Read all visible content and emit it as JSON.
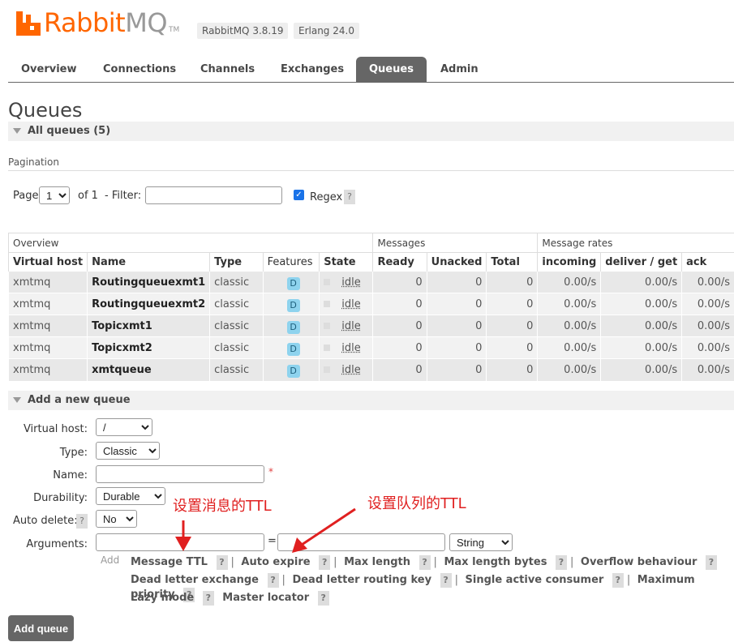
{
  "header": {
    "brand_part1": "Rabbit",
    "brand_part2": "MQ",
    "trademark": "TM",
    "version_rabbitmq": "RabbitMQ 3.8.19",
    "version_erlang": "Erlang 24.0"
  },
  "tabs": [
    {
      "label": "Overview",
      "active": false
    },
    {
      "label": "Connections",
      "active": false
    },
    {
      "label": "Channels",
      "active": false
    },
    {
      "label": "Exchanges",
      "active": false
    },
    {
      "label": "Queues",
      "active": true
    },
    {
      "label": "Admin",
      "active": false
    }
  ],
  "page_title": "Queues",
  "all_queues_label": "All queues (5)",
  "pagination": {
    "title": "Pagination",
    "page_label": "Page",
    "page_value": "1",
    "of_label": "of 1",
    "filter_label": "- Filter:",
    "filter_value": "",
    "regex_label": "Regex",
    "regex_checked": true,
    "help": "?"
  },
  "table": {
    "groups": [
      "Overview",
      "Messages",
      "Message rates"
    ],
    "headers": [
      "Virtual host",
      "Name",
      "Type",
      "Features",
      "State",
      "Ready",
      "Unacked",
      "Total",
      "incoming",
      "deliver / get",
      "ack"
    ],
    "rows": [
      {
        "vhost": "xmtmq",
        "name": "Routingqueuexmt1",
        "type": "classic",
        "feature": "D",
        "state": "idle",
        "ready": "0",
        "unacked": "0",
        "total": "0",
        "incoming": "0.00/s",
        "deliver": "0.00/s",
        "ack": "0.00/s"
      },
      {
        "vhost": "xmtmq",
        "name": "Routingqueuexmt2",
        "type": "classic",
        "feature": "D",
        "state": "idle",
        "ready": "0",
        "unacked": "0",
        "total": "0",
        "incoming": "0.00/s",
        "deliver": "0.00/s",
        "ack": "0.00/s"
      },
      {
        "vhost": "xmtmq",
        "name": "Topicxmt1",
        "type": "classic",
        "feature": "D",
        "state": "idle",
        "ready": "0",
        "unacked": "0",
        "total": "0",
        "incoming": "0.00/s",
        "deliver": "0.00/s",
        "ack": "0.00/s"
      },
      {
        "vhost": "xmtmq",
        "name": "Topicxmt2",
        "type": "classic",
        "feature": "D",
        "state": "idle",
        "ready": "0",
        "unacked": "0",
        "total": "0",
        "incoming": "0.00/s",
        "deliver": "0.00/s",
        "ack": "0.00/s"
      },
      {
        "vhost": "xmtmq",
        "name": "xmtqueue",
        "type": "classic",
        "feature": "D",
        "state": "idle",
        "ready": "0",
        "unacked": "0",
        "total": "0",
        "incoming": "0.00/s",
        "deliver": "0.00/s",
        "ack": "0.00/s"
      }
    ]
  },
  "add_queue": {
    "section_label": "Add a new queue",
    "virtual_host_label": "Virtual host:",
    "virtual_host_value": "/",
    "type_label": "Type:",
    "type_value": "Classic",
    "name_label": "Name:",
    "name_value": "",
    "required_mark": "*",
    "durability_label": "Durability:",
    "durability_value": "Durable",
    "auto_delete_label": "Auto delete:",
    "auto_delete_value": "No",
    "arguments_label": "Arguments:",
    "arg_equals": "=",
    "arg_type_value": "String",
    "add_label": "Add",
    "arg_shortcuts_line1": [
      "Message TTL",
      "Auto expire",
      "Max length",
      "Max length bytes",
      "Overflow behaviour"
    ],
    "arg_shortcuts_line2": [
      "Dead letter exchange",
      "Dead letter routing key",
      "Single active consumer",
      "Maximum priority"
    ],
    "arg_shortcuts_line3": [
      "Lazy mode",
      "Master locator"
    ],
    "button_label": "Add queue"
  },
  "annotations": {
    "message_ttl_note": "设置消息的TTL",
    "queue_ttl_note": "设置队列的TTL",
    "color": "#e02020"
  },
  "colors": {
    "brand": "#ff6600",
    "tab_active": "#666666",
    "durable_badge": "#8ed3ee"
  }
}
